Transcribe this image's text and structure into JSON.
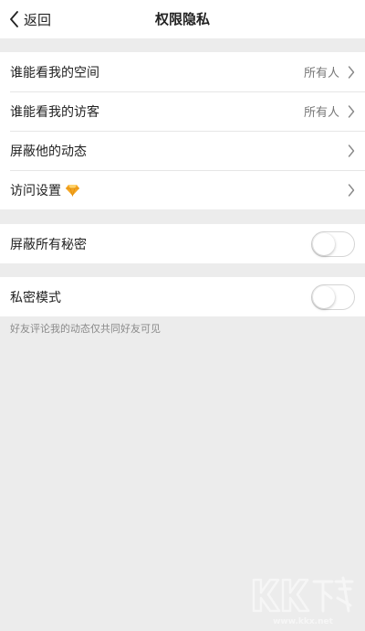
{
  "header": {
    "back_label": "返回",
    "title": "权限隐私",
    "back_icon": "chevron-left-icon"
  },
  "groups": [
    {
      "rows": [
        {
          "label": "谁能看我的空间",
          "value": "所有人",
          "accessory": "chevron-right-icon"
        },
        {
          "label": "谁能看我的访客",
          "value": "所有人",
          "accessory": "chevron-right-icon"
        },
        {
          "label": "屏蔽他的动态",
          "accessory": "chevron-right-icon"
        },
        {
          "label": "访问设置",
          "badge_icon": "yellow-diamond-icon",
          "accessory": "chevron-right-icon"
        }
      ]
    },
    {
      "rows": [
        {
          "label": "屏蔽所有秘密",
          "toggle_on": false
        }
      ]
    },
    {
      "rows": [
        {
          "label": "私密模式",
          "toggle_on": false
        }
      ]
    }
  ],
  "footer_hint": "好友评论我的动态仅共同好友可见",
  "watermark": {
    "brand": "KK下载",
    "url": "www.kkx.net"
  },
  "colors": {
    "background": "#ececec",
    "surface": "#ffffff",
    "diamond": "#f5a623",
    "secondary_text": "#777777"
  }
}
